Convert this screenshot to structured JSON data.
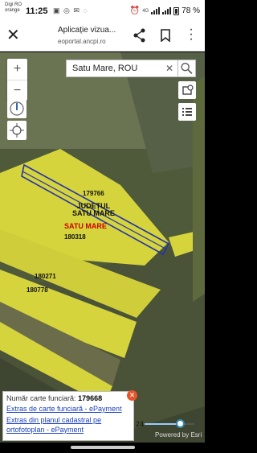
{
  "status_bar": {
    "carrier_line1": "Digi RO",
    "carrier_line2": "orange",
    "time": "11:25",
    "network": "4G",
    "battery": "78 %"
  },
  "app_bar": {
    "title": "Aplicație vizua...",
    "url": "eoportal.ancpi.ro"
  },
  "map": {
    "search_value": "Satu Mare, ROU",
    "parcels": [
      {
        "id": "179766"
      },
      {
        "id": "180318"
      },
      {
        "id": "180271"
      },
      {
        "id": "180778"
      }
    ],
    "region_label_line1": "JUDEȚUL",
    "region_label_line2": "SATU MARE",
    "region_label_red": "SATU MARE"
  },
  "popup": {
    "label": "Număr carte funciară:",
    "value": "179668",
    "link1": "Extras de carte funciară - ePayment",
    "link2": "Extras din planul cadastral pe ortofotoplan - ePayment"
  },
  "slider": {
    "label": "24",
    "value_fraction": 0.72
  },
  "attribution": "Powered by Esri",
  "colors": {
    "parcel_fill": "#d6d43c",
    "parcel_selected": "#2233aa",
    "close_button": "#e8542a",
    "link": "#1a3fbf"
  }
}
